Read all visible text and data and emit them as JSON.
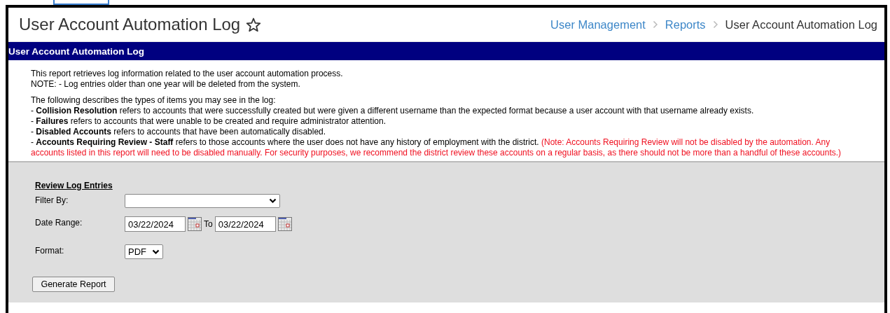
{
  "header": {
    "title": "User Account Automation Log",
    "breadcrumb": [
      {
        "label": "User Management",
        "kind": "link"
      },
      {
        "label": "Reports",
        "kind": "link"
      },
      {
        "label": "User Account Automation Log",
        "kind": "current"
      }
    ]
  },
  "section_bar": {
    "title": "User Account Automation Log"
  },
  "intro": [
    "This report retrieves log information related to the user account automation process.",
    "NOTE: - Log entries older than one year will be deleted from the system."
  ],
  "legend": {
    "heading": "The following describes the types of items you may see in the log:",
    "items": [
      {
        "text": "- **Collision Resolution** refers to accounts that were successfully created but were given a different username than the expected format because a user account with that username already exists."
      },
      {
        "text": "- **Failures** refers to accounts that were unable to be created and require administrator attention."
      },
      {
        "text": "- **Disabled Accounts** refers to accounts that have been automatically disabled."
      },
      {
        "text": "- **Accounts Requiring Review - Staff** refers to those accounts where the user does not have any history of employment with the district.",
        "note": "(Note: Accounts Requiring Review will not be disabled by the automation. Any accounts listed in this report will need to be disabled manually. For security purposes, we recommend the district review these accounts on a regular basis, as there should not be more than a handful of these accounts.)"
      }
    ]
  },
  "form": {
    "heading": "Review Log Entries",
    "filter_by": {
      "label": "Filter By:"
    },
    "date_range": {
      "label": "Date Range:",
      "from": "03/22/2024",
      "separator": "To",
      "to": "03/22/2024"
    },
    "format": {
      "label": "Format:",
      "value": "PDF"
    },
    "button": "Generate Report"
  }
}
